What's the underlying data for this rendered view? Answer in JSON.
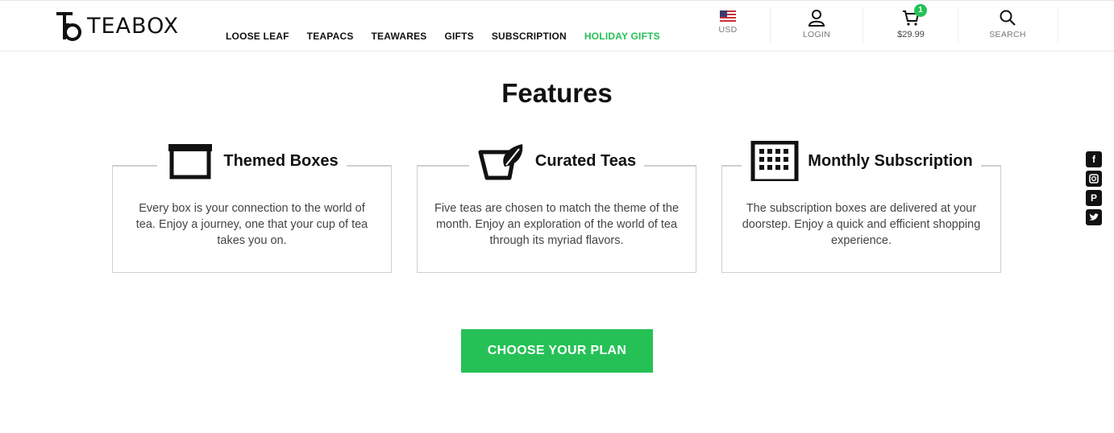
{
  "header": {
    "brand": "TEABOX",
    "nav": [
      {
        "label": "LOOSE LEAF"
      },
      {
        "label": "TEAPACS"
      },
      {
        "label": "TEAWARES"
      },
      {
        "label": "GIFTS"
      },
      {
        "label": "SUBSCRIPTION"
      },
      {
        "label": "HOLIDAY GIFTS",
        "accent": true
      }
    ],
    "currency": "USD",
    "login": "LOGIN",
    "cart_count": "1",
    "cart_total": "$29.99",
    "search": "SEARCH"
  },
  "main": {
    "title": "Features",
    "features": [
      {
        "title": "Themed Boxes",
        "icon": "box-icon",
        "text": "Every box is your connection to the world of tea. Enjoy a journey, one that your cup of tea takes you on."
      },
      {
        "title": "Curated Teas",
        "icon": "tea-leaf-cup-icon",
        "text": "Five teas are chosen to match the theme of the month. Enjoy an exploration of the world of tea through its myriad flavors."
      },
      {
        "title": "Monthly Subscription",
        "icon": "calendar-icon",
        "text": "The subscription boxes are delivered at your doorstep. Enjoy a quick and efficient shopping experience."
      }
    ],
    "cta": "CHOOSE YOUR PLAN"
  },
  "social": [
    "facebook-icon",
    "instagram-icon",
    "pinterest-icon",
    "twitter-icon"
  ],
  "colors": {
    "accent": "#25c156",
    "text": "#111111",
    "border": "#cfcfcf"
  }
}
